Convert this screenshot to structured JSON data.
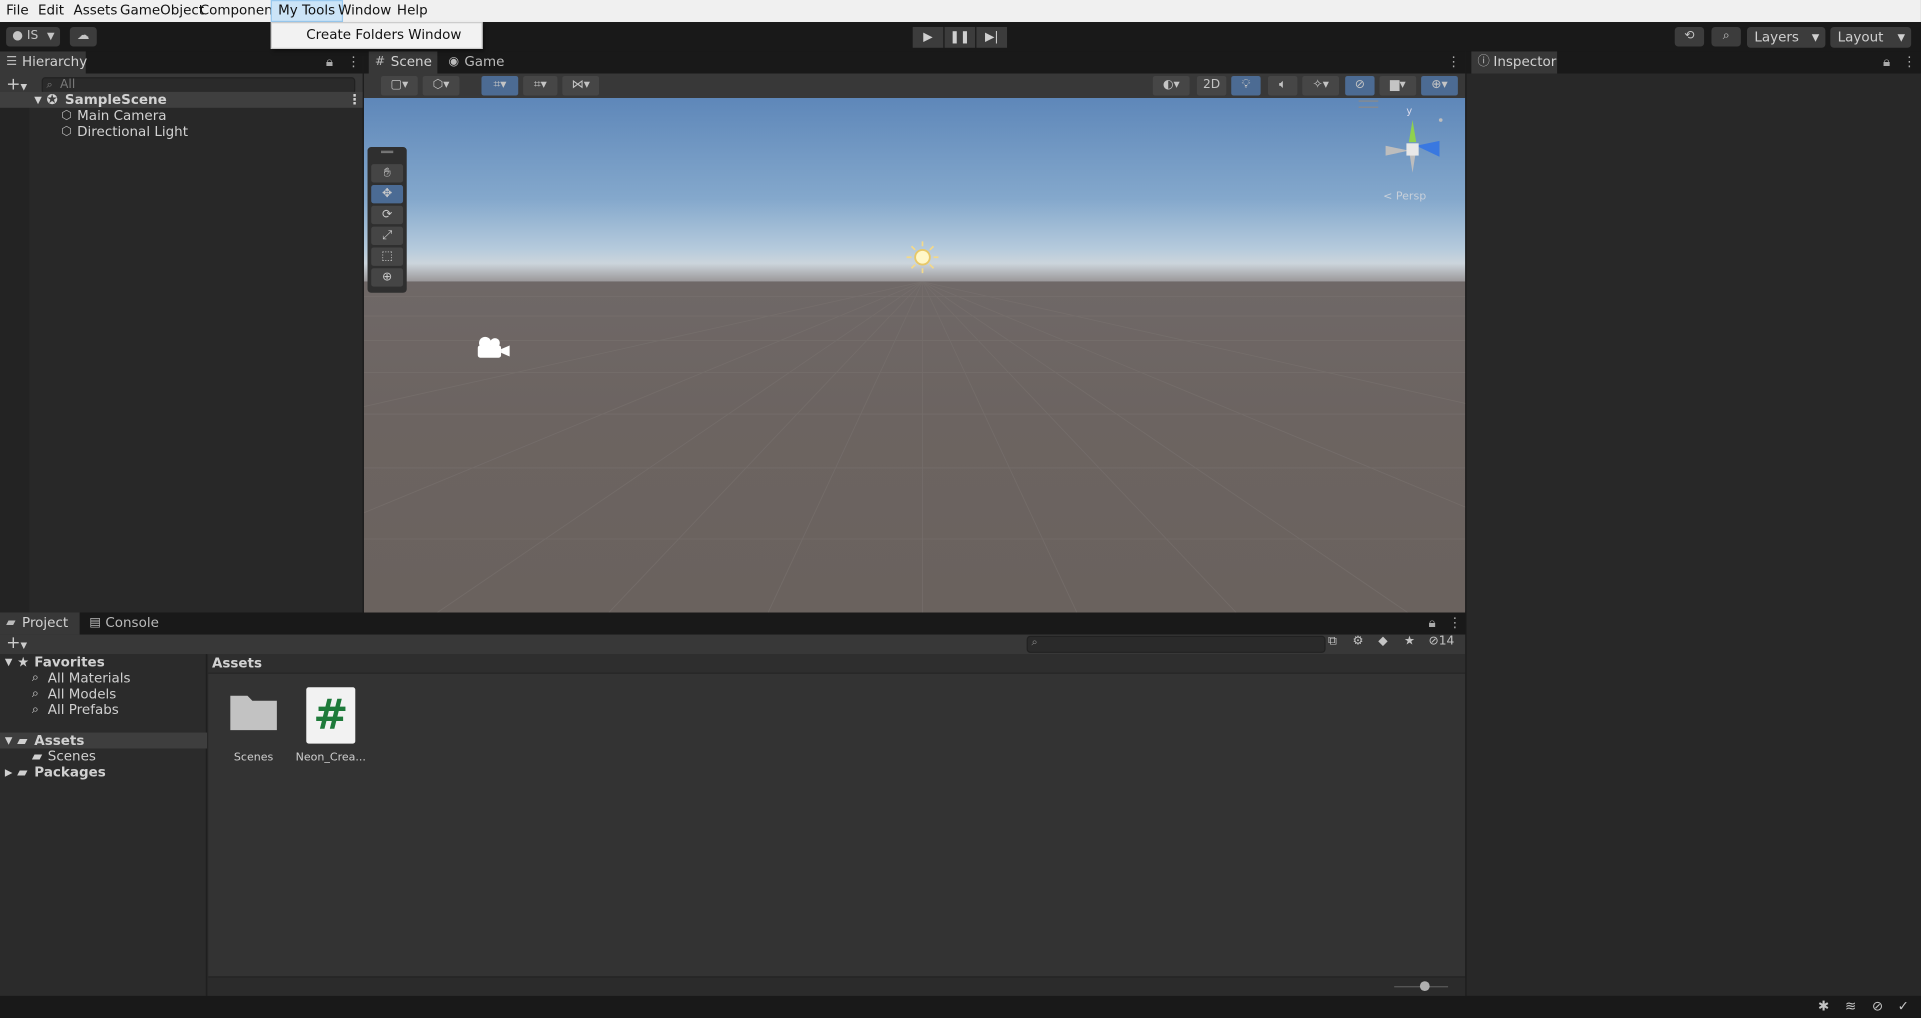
{
  "menubar": {
    "items": [
      "File",
      "Edit",
      "Assets",
      "GameObject",
      "Component",
      "My Tools",
      "Window",
      "Help"
    ],
    "dropdown_item": "Create Folders Window"
  },
  "toolbar": {
    "account_label": "IS",
    "layers_label": "Layers",
    "layout_label": "Layout"
  },
  "hierarchy": {
    "tab_label": "Hierarchy",
    "search_placeholder": "All",
    "scene_name": "SampleScene",
    "objects": [
      "Main Camera",
      "Directional Light"
    ]
  },
  "scene": {
    "tabs": [
      "Scene",
      "Game"
    ],
    "mode_2d_label": "2D",
    "persp_label": "< Persp",
    "gizmo_y": "y"
  },
  "inspector": {
    "tab_label": "Inspector"
  },
  "project": {
    "tabs": [
      "Project",
      "Console"
    ],
    "hidden_count": "14",
    "favorites_label": "Favorites",
    "favorites": [
      "All Materials",
      "All Models",
      "All Prefabs"
    ],
    "assets_label": "Assets",
    "asset_children": [
      "Scenes"
    ],
    "packages_label": "Packages",
    "breadcrumb": "Assets",
    "items": [
      {
        "name": "Scenes",
        "kind": "folder"
      },
      {
        "name": "Neon_Crea...",
        "kind": "script"
      }
    ]
  },
  "colors": {
    "accent": "#4b6b94",
    "script_green": "#1e7a3a"
  }
}
